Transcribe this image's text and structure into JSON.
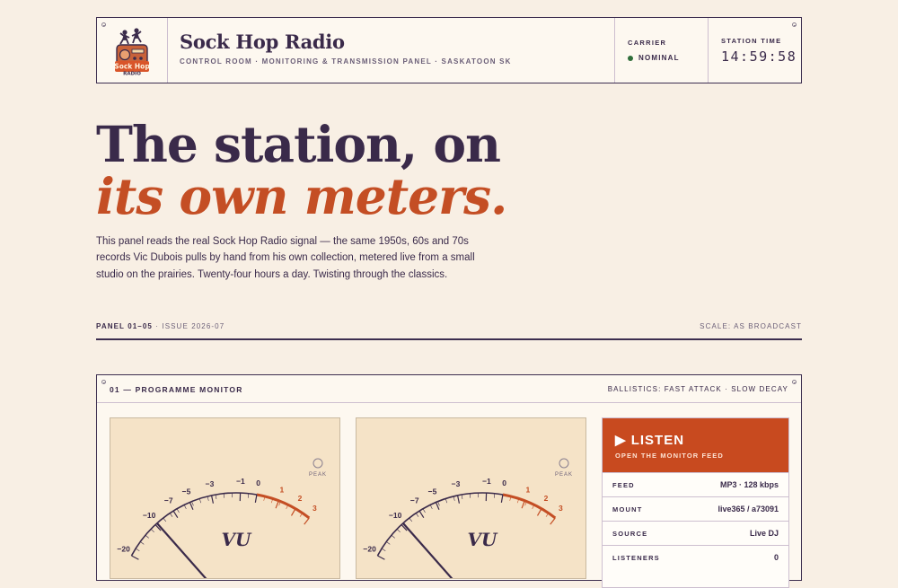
{
  "header": {
    "brand_name": "Sock Hop Radio",
    "brand_subtitle": "CONTROL ROOM · MONITORING & TRANSMISSION PANEL · SASKATOON SK",
    "logo_text_line1": "Sock Hop",
    "logo_text_line2": "RADIO",
    "carrier_label": "CARRIER",
    "carrier_status": "NOMINAL",
    "time_label": "STATION TIME",
    "time_value": "14:59:58"
  },
  "hero": {
    "line1": "The station, on",
    "line2": "its own meters.",
    "intro": "This panel reads the real Sock Hop Radio signal — the same 1950s, 60s and 70s records Vic Dubois pulls by hand from his own collection, metered live from a small studio on the prairies. Twenty-four hours a day. Twisting through the classics."
  },
  "panel_line": {
    "panel": "PANEL 01–05",
    "issue": "· ISSUE 2026-07",
    "scale": "SCALE: AS BROADCAST"
  },
  "monitor": {
    "title": "01 — PROGRAMME MONITOR",
    "ballistics": "BALLISTICS: FAST ATTACK · SLOW DECAY",
    "meter_label": "VU",
    "peak_label": "PEAK",
    "scale_ticks": [
      "−20",
      "−10",
      "−7",
      "−5",
      "−3",
      "−1",
      "0",
      "1",
      "2",
      "3"
    ],
    "listen_title": "▶ LISTEN",
    "listen_sub": "OPEN THE MONITOR FEED",
    "specs": [
      {
        "key": "FEED",
        "value": "MP3 · 128 kbps"
      },
      {
        "key": "MOUNT",
        "value": "live365 / a73091"
      },
      {
        "key": "SOURCE",
        "value": "Live DJ"
      },
      {
        "key": "LISTENERS",
        "value": "0"
      }
    ]
  },
  "colors": {
    "background": "#f8efe4",
    "ink": "#3a2a4a",
    "accent": "#c44e24",
    "carrier_ok": "#2f6e3a"
  }
}
